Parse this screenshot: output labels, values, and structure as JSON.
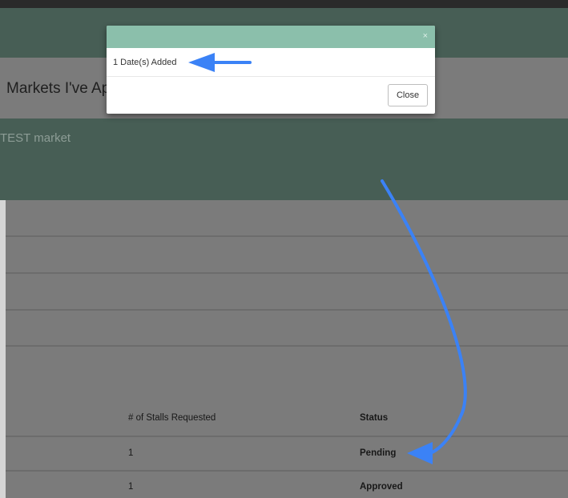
{
  "page": {
    "title": "Markets I've Ap",
    "market_name": "TEST market"
  },
  "table": {
    "columns": [
      "# of Stalls Requested",
      "Status"
    ],
    "rows": [
      {
        "stalls": "1",
        "status": "Pending"
      },
      {
        "stalls": "1",
        "status": "Approved"
      }
    ]
  },
  "modal": {
    "close_x": "×",
    "message": "1 Date(s) Added",
    "close_button": "Close"
  },
  "colors": {
    "modal_header": "#8bbfab",
    "annotation_arrow": "#3b82f6",
    "nav_band": "#475e55"
  }
}
